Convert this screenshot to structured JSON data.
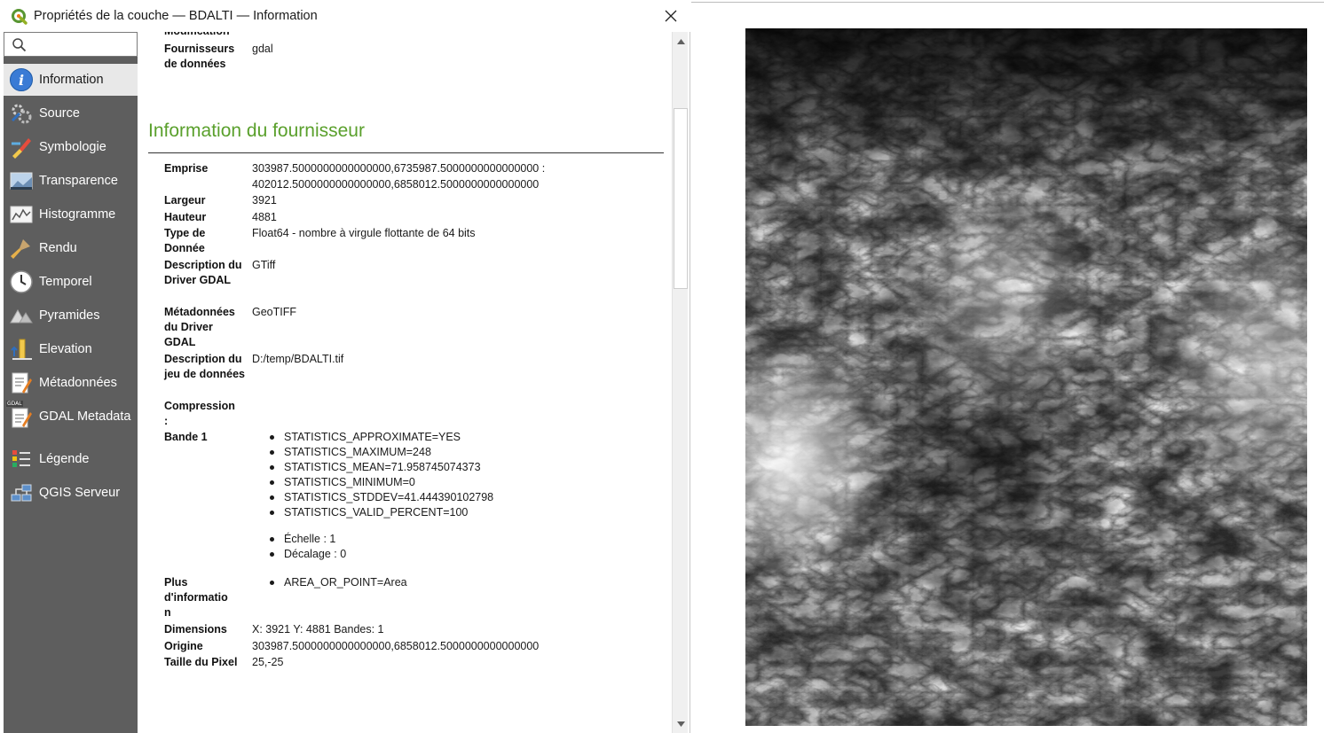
{
  "window": {
    "title": "Propriétés de la couche — BDALTI — Information",
    "logo_icon": "qgis-logo-icon",
    "close_icon": "close-icon"
  },
  "sidebar": {
    "search": {
      "placeholder": "",
      "value": "",
      "icon": "search-icon"
    },
    "items": [
      {
        "label": "Information",
        "icon": "info-icon",
        "active": true
      },
      {
        "label": "Source",
        "icon": "source-gear-icon"
      },
      {
        "label": "Symbologie",
        "icon": "symbology-brush-icon"
      },
      {
        "label": "Transparence",
        "icon": "transparency-icon"
      },
      {
        "label": "Histogramme",
        "icon": "histogram-icon"
      },
      {
        "label": "Rendu",
        "icon": "render-brush-icon"
      },
      {
        "label": "Temporel",
        "icon": "clock-icon"
      },
      {
        "label": "Pyramides",
        "icon": "pyramids-icon"
      },
      {
        "label": "Elevation",
        "icon": "elevation-icon"
      },
      {
        "label": "Métadonnées",
        "icon": "metadata-icon"
      },
      {
        "label": "GDAL Metadata",
        "icon": "gdal-metadata-icon",
        "badge": "GDAL"
      },
      {
        "label": "Légende",
        "icon": "legend-icon"
      },
      {
        "label": "QGIS Serveur",
        "icon": "server-icon"
      }
    ]
  },
  "content": {
    "partial_heading": "Modification",
    "providers": {
      "key": "Fournisseurs de données",
      "value": "gdal"
    },
    "section_title": "Information du fournisseur",
    "emprise": {
      "key": "Emprise",
      "line1": "303987.5000000000000000,6735987.5000000000000000 :",
      "line2": "402012.5000000000000000,6858012.5000000000000000"
    },
    "largeur": {
      "key": "Largeur",
      "value": "3921"
    },
    "hauteur": {
      "key": "Hauteur",
      "value": "4881"
    },
    "type": {
      "key": "Type de Donnée",
      "value": "Float64 - nombre à virgule flottante de 64 bits"
    },
    "driver_desc": {
      "key": "Description du Driver GDAL",
      "value": "GTiff"
    },
    "driver_meta": {
      "key": "Métadonnées du Driver GDAL",
      "value": "GeoTIFF"
    },
    "dataset_desc": {
      "key": "Description du jeu de données",
      "value": "D:/temp/BDALTI.tif"
    },
    "compression": {
      "key": "Compression :",
      "value": ""
    },
    "bande1": {
      "key": "Bande 1",
      "stats": [
        "STATISTICS_APPROXIMATE=YES",
        "STATISTICS_MAXIMUM=248",
        "STATISTICS_MEAN=71.958745074373",
        "STATISTICS_MINIMUM=0",
        "STATISTICS_STDDEV=41.444390102798",
        "STATISTICS_VALID_PERCENT=100"
      ],
      "scale": [
        "Échelle : 1",
        "Décalage : 0"
      ]
    },
    "plus": {
      "key": "Plus d'informatio n",
      "items": [
        "AREA_OR_POINT=Area"
      ]
    },
    "dimensions": {
      "key": "Dimensions",
      "value": "X: 3921 Y: 4881 Bandes: 1"
    },
    "origine": {
      "key": "Origine",
      "value": "303987.5000000000000000,6858012.5000000000000000"
    },
    "pixel": {
      "key": "Taille du Pixel",
      "value": "25,-25"
    }
  },
  "scrollbar": {
    "position_fraction": 0.09,
    "visible_fraction": 0.27
  },
  "map": {
    "raster": "elevation-raster"
  }
}
